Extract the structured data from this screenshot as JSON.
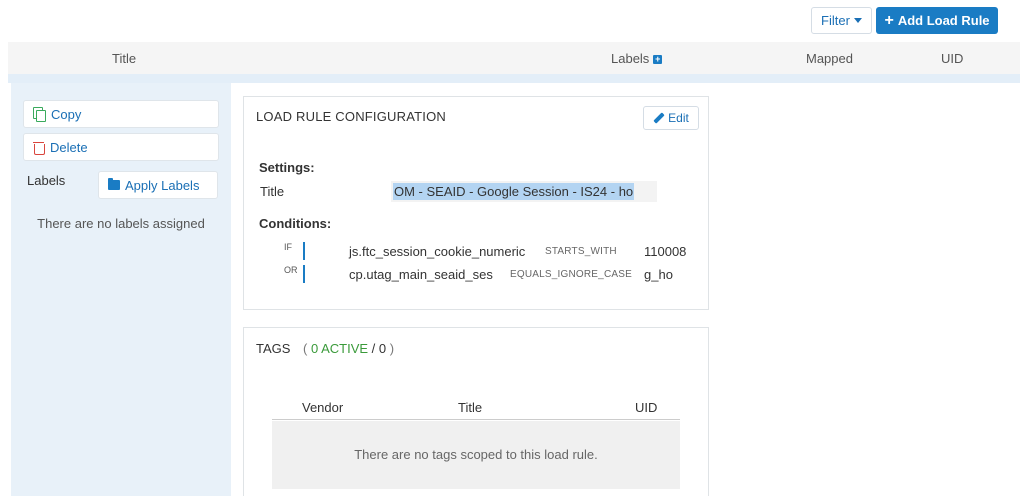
{
  "toolbar": {
    "filter_label": "Filter",
    "add_label": "Add Load Rule"
  },
  "table_header": {
    "title": "Title",
    "labels": "Labels",
    "labels_plus": "+",
    "mapped": "Mapped",
    "uid": "UID"
  },
  "sidebar": {
    "copy_label": "Copy",
    "delete_label": "Delete",
    "labels_heading": "Labels",
    "apply_labels": "Apply Labels",
    "no_labels": "There are no labels assigned"
  },
  "config": {
    "heading": "LOAD RULE CONFIGURATION",
    "edit_label": "Edit",
    "settings_heading": "Settings:",
    "title_label": "Title",
    "title_value": "OM - SEAID - Google Session - IS24 - ho",
    "conditions_heading": "Conditions:",
    "conditions": [
      {
        "op": "IF",
        "variable": "js.ftc_session_cookie_numeric",
        "comparator": "STARTS_WITH",
        "value": "110008"
      },
      {
        "op": "OR",
        "variable": "cp.utag_main_seaid_ses",
        "comparator": "EQUALS_IGNORE_CASE",
        "value": "g_ho"
      }
    ]
  },
  "tags": {
    "heading": "TAGS",
    "open_paren": "(",
    "active": "0 ACTIVE",
    "slash": "/",
    "total": "0",
    "close_paren": ")",
    "columns": {
      "vendor": "Vendor",
      "title": "Title",
      "uid": "UID"
    },
    "empty_text": "There are no tags scoped to this load rule."
  },
  "colors": {
    "accent": "#1a7cc4",
    "active_green": "#3a9a3a",
    "delete_red": "#d9453d",
    "copy_green": "#3aaa5c",
    "sidebar_bg": "#e8f1f9"
  }
}
